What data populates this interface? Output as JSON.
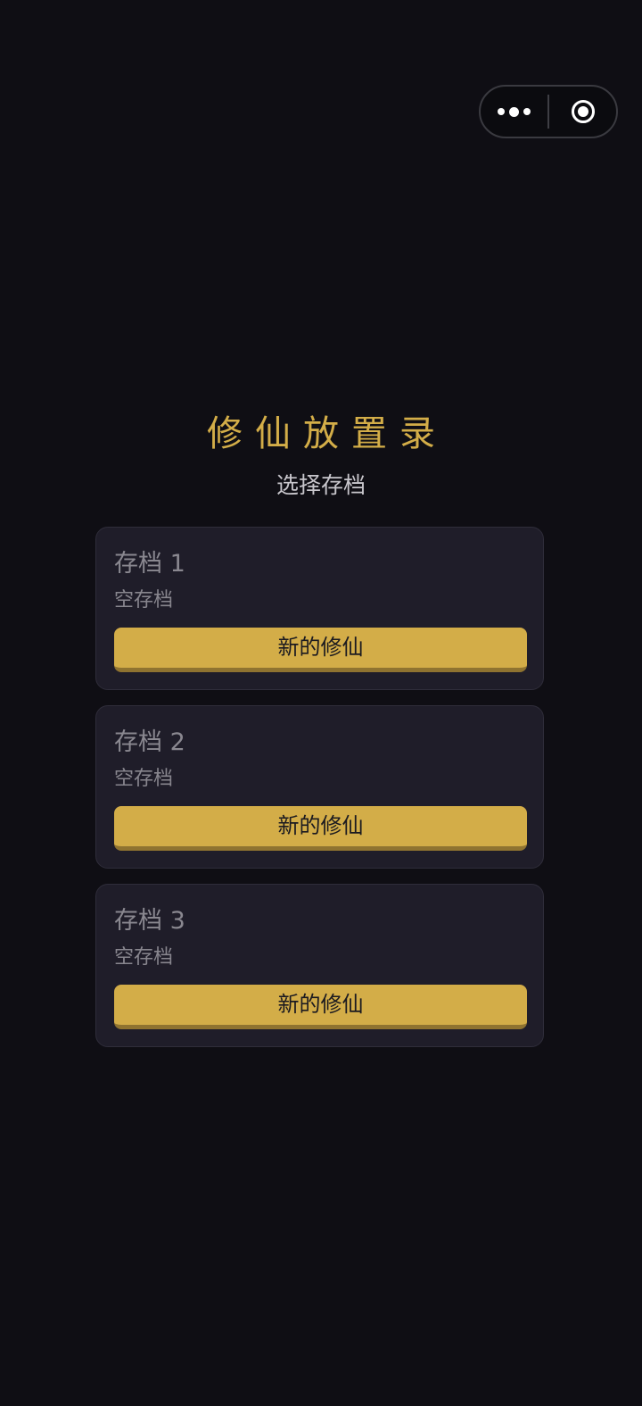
{
  "game": {
    "title": "修仙放置录",
    "subtitle": "选择存档"
  },
  "capsule": {
    "icons": [
      "more-dots-icon",
      "close-target-icon"
    ]
  },
  "slots": [
    {
      "name": "存档 1",
      "status": "空存档",
      "action_label": "新的修仙"
    },
    {
      "name": "存档 2",
      "status": "空存档",
      "action_label": "新的修仙"
    },
    {
      "name": "存档 3",
      "status": "空存档",
      "action_label": "新的修仙"
    }
  ],
  "colors": {
    "background": "#0f0e14",
    "accent_gold": "#d3ad48",
    "card_bg": "#1f1d29",
    "button_shadow": "#8f7330"
  }
}
